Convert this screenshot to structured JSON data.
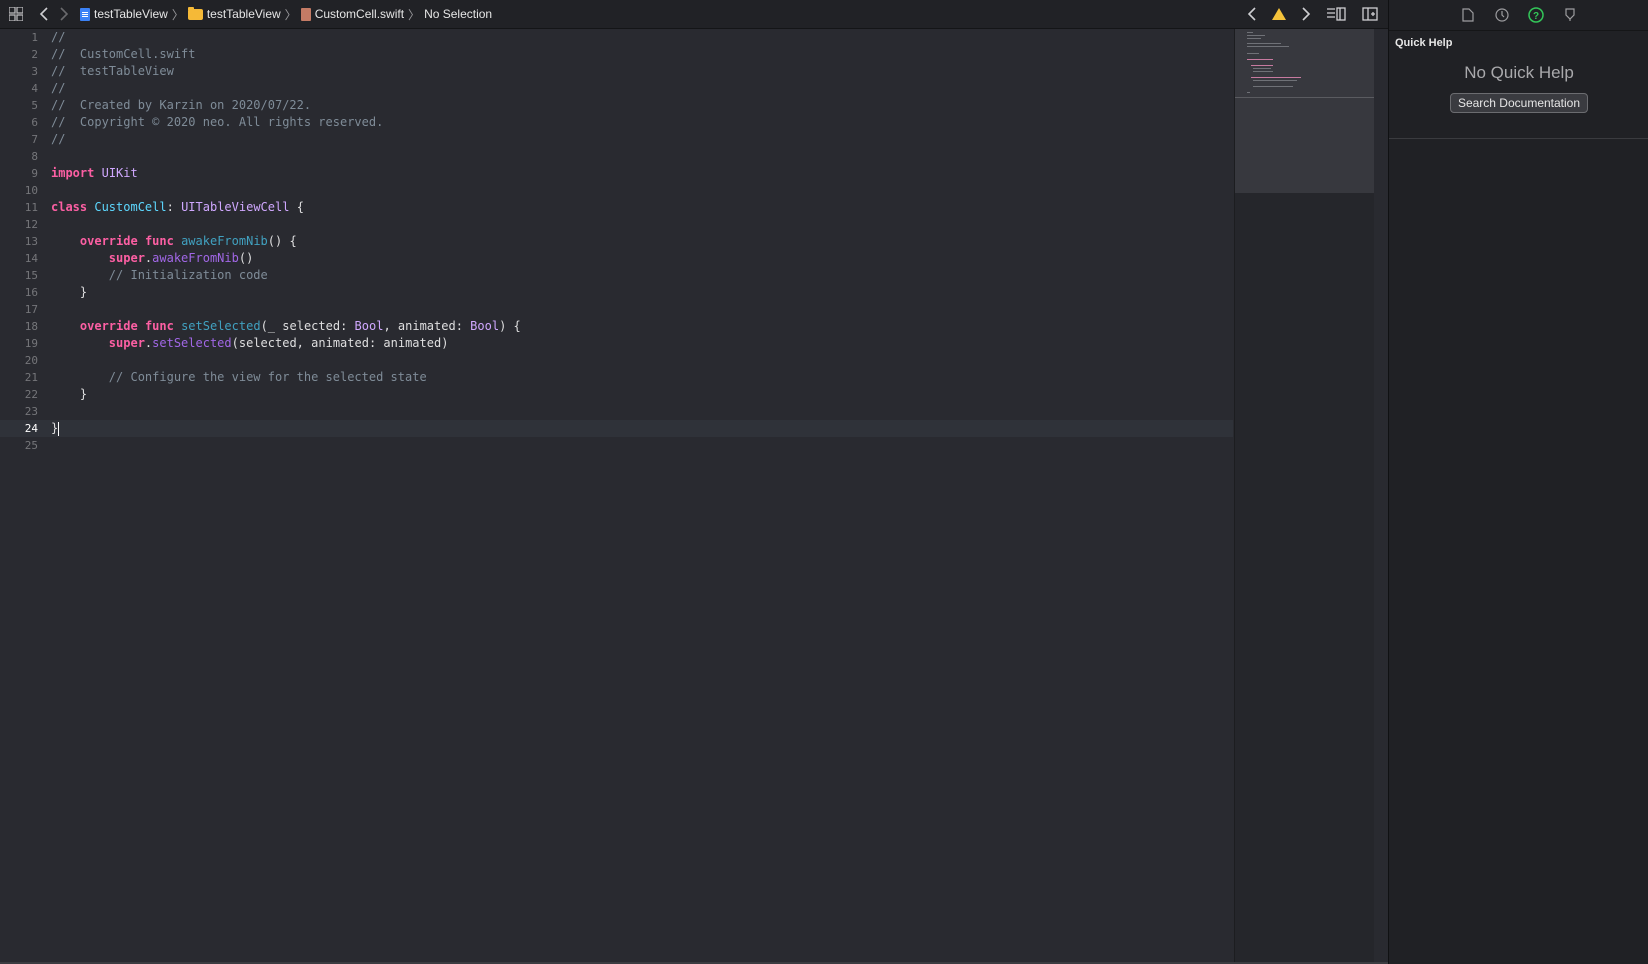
{
  "jumpbar": {
    "crumbs": [
      "testTableView",
      "testTableView",
      "CustomCell.swift",
      "No Selection"
    ]
  },
  "editor": {
    "active_line": 24,
    "lines": [
      "//",
      "//  CustomCell.swift",
      "//  testTableView",
      "//",
      "//  Created by Karzin on 2020/07/22.",
      "//  Copyright © 2020 neo. All rights reserved.",
      "//",
      "",
      "import UIKit",
      "",
      "class CustomCell: UITableViewCell {",
      "",
      "    override func awakeFromNib() {",
      "        super.awakeFromNib()",
      "        // Initialization code",
      "    }",
      "",
      "    override func setSelected(_ selected: Bool, animated: Bool) {",
      "        super.setSelected(selected, animated: animated)",
      "",
      "        // Configure the view for the selected state",
      "    }",
      "",
      "}",
      ""
    ]
  },
  "inspector": {
    "title": "Quick Help",
    "empty_message": "No Quick Help",
    "search_button": "Search Documentation"
  },
  "colors": {
    "background": "#292a30",
    "keyword": "#fc5fa3",
    "type": "#5dd8ff",
    "comment": "#7f8c98"
  }
}
